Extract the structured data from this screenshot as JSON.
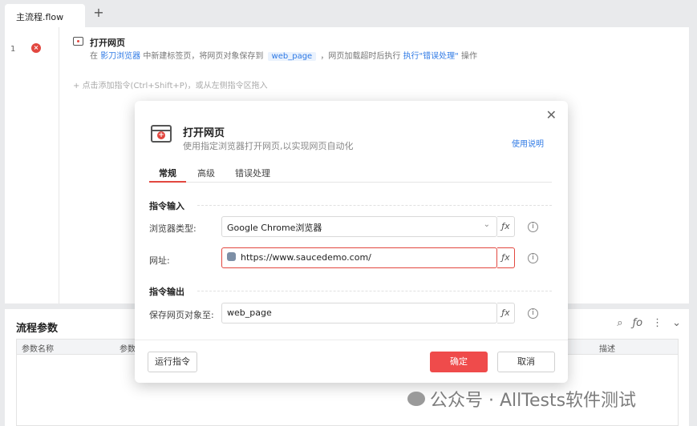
{
  "tabbar": {
    "active_tab": "主流程.flow",
    "add_label": "+"
  },
  "editor": {
    "line_number": "1",
    "command_title": "打开网页",
    "desc": {
      "p1": "在 ",
      "browser_link": "影刀浏览器",
      "p2": " 中新建标签页，将网页对象保存到 ",
      "var_chip": "web_page",
      "p3": " ，网页加载超时后执行 ",
      "error_link": "执行\"错误处理\"",
      "p4": " 操作"
    },
    "add_hint": "点击添加指令(Ctrl+Shift+P)，或从左侧指令区拖入"
  },
  "params": {
    "title": "流程参数",
    "columns": [
      "参数名称",
      "参数",
      "描述"
    ]
  },
  "dialog": {
    "title": "打开网页",
    "subtitle": "使用指定浏览器打开网页,以实现网页自动化",
    "help_link": "使用说明",
    "tabs": [
      "常规",
      "高级",
      "错误处理"
    ],
    "input_section": "指令输入",
    "browser_label": "浏览器类型:",
    "browser_value": "Google Chrome浏览器",
    "url_label": "网址:",
    "url_value": "https://www.saucedemo.com/",
    "output_section": "指令输出",
    "save_label": "保存网页对象至:",
    "save_value": "web_page",
    "fx": "ƒx",
    "run_btn": "运行指令",
    "ok_btn": "确定",
    "cancel_btn": "取消"
  },
  "watermark": {
    "text": "公众号 · AllTests软件测试"
  },
  "colors": {
    "accent": "#ef4b4b",
    "link": "#2f7ae5"
  }
}
